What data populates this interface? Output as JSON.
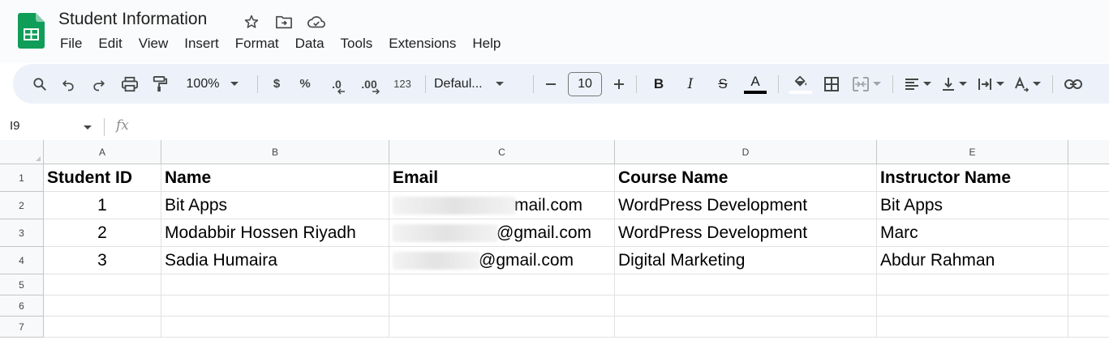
{
  "app": {
    "doc_title": "Student Information",
    "brand_color": "#0f9d58"
  },
  "title_icons": [
    {
      "name": "star-icon"
    },
    {
      "name": "move-to-folder-icon"
    },
    {
      "name": "cloud-saved-icon"
    }
  ],
  "menu": [
    "File",
    "Edit",
    "View",
    "Insert",
    "Format",
    "Data",
    "Tools",
    "Extensions",
    "Help"
  ],
  "toolbar": {
    "zoom": "100%",
    "currency": "$",
    "percent": "%",
    "decrease_decimal": ".0",
    "increase_decimal": ".00",
    "number_format": "123",
    "font": "Defaul...",
    "font_size": "10",
    "bold": "B",
    "italic": "I",
    "strikethrough": "S",
    "text_color_letter": "A",
    "text_color": "#000000"
  },
  "formula_bar": {
    "name_box": "I9",
    "fx_label": "fx"
  },
  "sheet": {
    "columns": [
      "A",
      "B",
      "C",
      "D",
      "E"
    ],
    "rows": [
      "1",
      "2",
      "3",
      "4",
      "5",
      "6",
      "7"
    ],
    "header": [
      "Student ID",
      "Name",
      "Email",
      "Course Name",
      "Instructor Name"
    ],
    "data": [
      {
        "id": "1",
        "name": "Bit Apps",
        "email_visible": "mail.com",
        "course": "WordPress Development",
        "instructor": "Bit Apps"
      },
      {
        "id": "2",
        "name": "Modabbir Hossen Riyadh",
        "email_visible": "@gmail.com",
        "course": "WordPress Development",
        "instructor": "Marc"
      },
      {
        "id": "3",
        "name": "Sadia Humaira",
        "email_visible": "@gmail.com",
        "course": "Digital Marketing",
        "instructor": "Abdur Rahman"
      }
    ]
  }
}
